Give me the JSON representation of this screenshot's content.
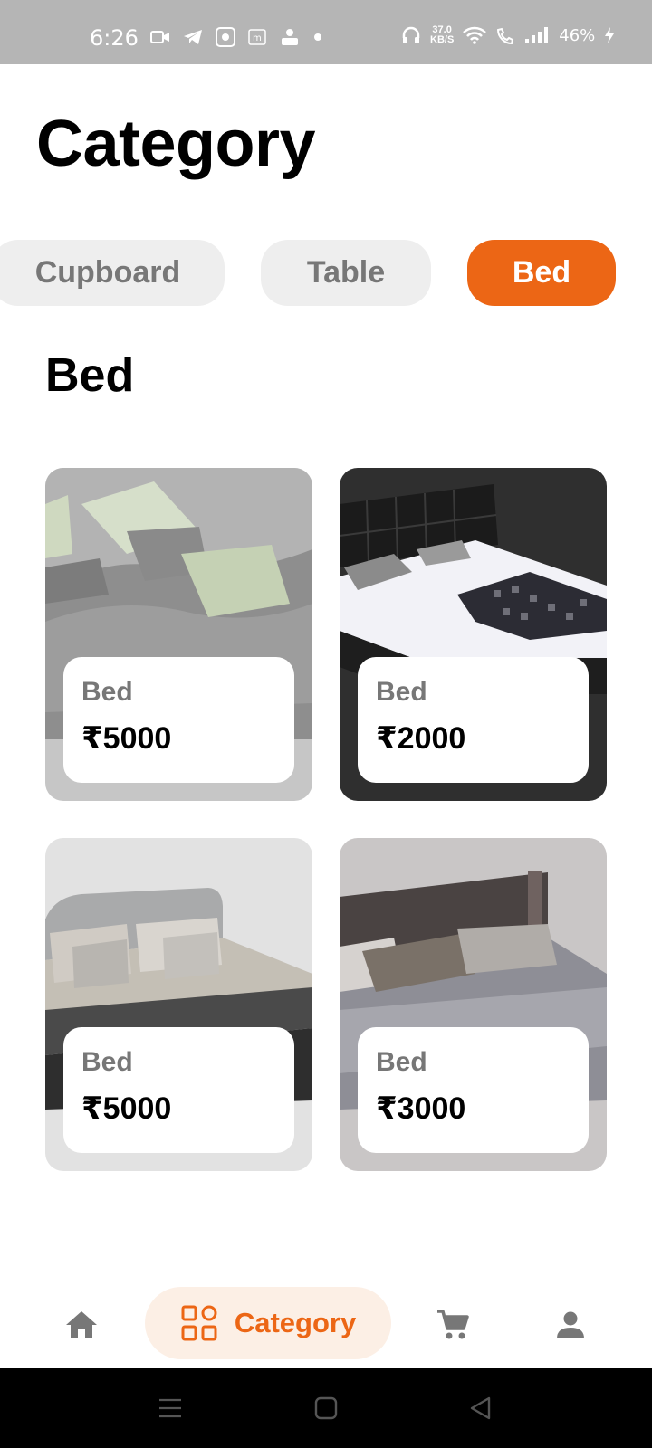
{
  "status_bar": {
    "time": "6:26",
    "net_speed_value": "37.0",
    "net_speed_unit": "KB/S",
    "battery": "46%"
  },
  "page": {
    "title": "Category"
  },
  "categories": [
    {
      "label": "Cupboard",
      "selected": false
    },
    {
      "label": "Table",
      "selected": false
    },
    {
      "label": "Bed",
      "selected": true
    }
  ],
  "section": {
    "title": "Bed"
  },
  "products": [
    {
      "name": "Bed",
      "price": "₹5000"
    },
    {
      "name": "Bed",
      "price": "₹2000"
    },
    {
      "name": "Bed",
      "price": "₹5000"
    },
    {
      "name": "Bed",
      "price": "₹3000"
    }
  ],
  "bottom_nav": {
    "items": [
      {
        "icon": "home-icon"
      },
      {
        "icon": "category-grid-icon",
        "label": "Category",
        "active": true
      },
      {
        "icon": "cart-icon"
      },
      {
        "icon": "profile-icon"
      }
    ]
  },
  "colors": {
    "accent": "#ec6615",
    "chip_bg": "#eeeeee",
    "active_nav_bg": "#fcefe5"
  }
}
